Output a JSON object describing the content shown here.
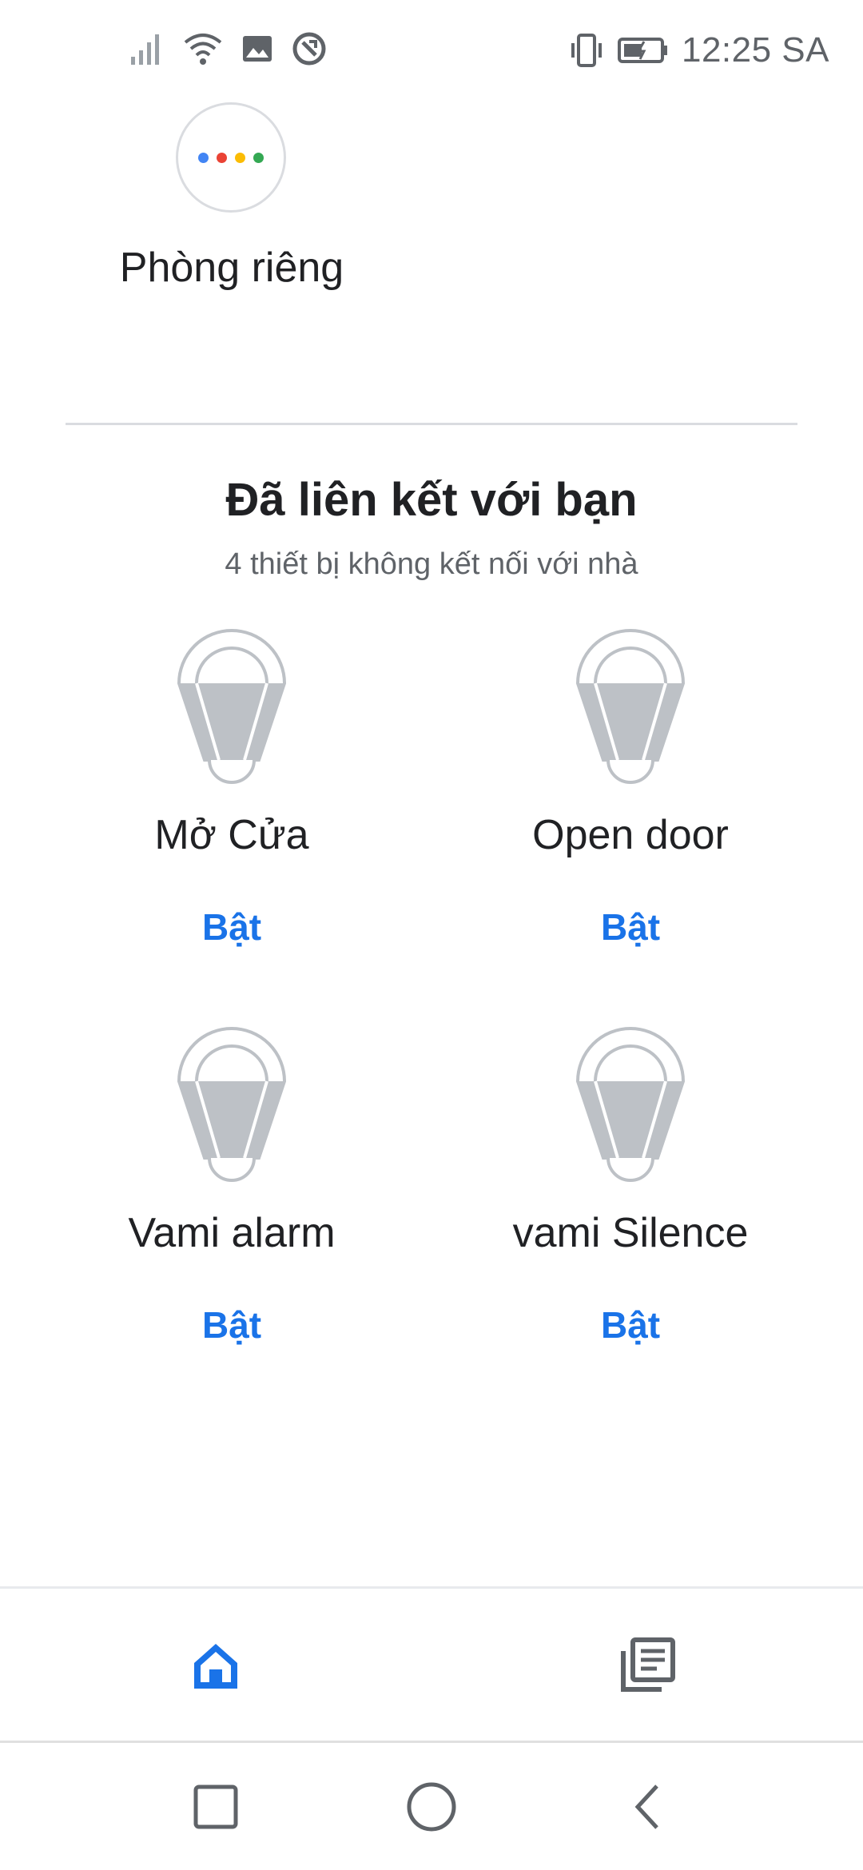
{
  "status_bar": {
    "time": "12:25 SA",
    "left_icons": [
      "signal-icon",
      "wifi-icon",
      "image-icon",
      "sync-icon"
    ],
    "right_icons": [
      "vibrate-icon",
      "battery-icon"
    ]
  },
  "room": {
    "label": "Phòng riêng",
    "avatar_dot_colors": [
      "#4285f4",
      "#ea4335",
      "#fbbc04",
      "#34a853"
    ]
  },
  "linked": {
    "title": "Đã liên kết với bạn",
    "subtitle": "4 thiết bị không kết nối với nhà"
  },
  "devices": [
    {
      "name": "Mở Cửa",
      "action": "Bật",
      "icon": "bulb-icon"
    },
    {
      "name": "Open door",
      "action": "Bật",
      "icon": "bulb-icon"
    },
    {
      "name": "Vami alarm",
      "action": "Bật",
      "icon": "bulb-icon"
    },
    {
      "name": "vami Silence",
      "action": "Bật",
      "icon": "bulb-icon"
    }
  ],
  "bottom_nav": {
    "tabs": [
      {
        "icon": "home-icon",
        "active": true
      },
      {
        "icon": "feed-icon",
        "active": false
      }
    ]
  },
  "colors": {
    "accent": "#1a73e8",
    "text_primary": "#202124",
    "text_secondary": "#5f6368",
    "icon_gray": "#bdc1c6",
    "divider": "#dadce0"
  }
}
